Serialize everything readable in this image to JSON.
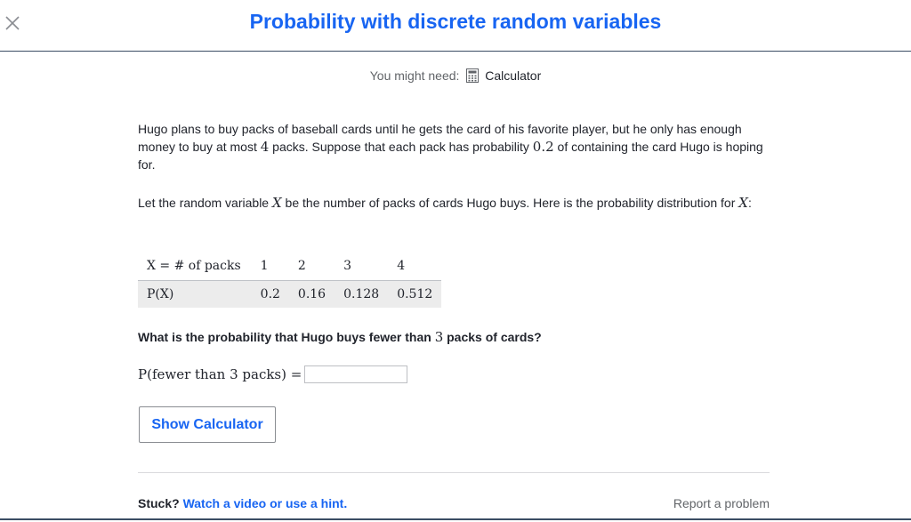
{
  "header": {
    "title": "Probability with discrete random variables",
    "close_icon": "close-icon"
  },
  "tools": {
    "label": "You might need:",
    "calculator_label": "Calculator",
    "calculator_icon": "calculator-icon"
  },
  "problem": {
    "p1_a": "Hugo plans to buy packs of baseball cards until he gets the card of his favorite player, but he only has enough money to buy at most ",
    "p1_num": "4",
    "p1_b": " packs. Suppose that each pack has probability ",
    "p1_prob": "0.2",
    "p1_c": " of containing the card Hugo is hoping for.",
    "p2_a": "Let the random variable ",
    "p2_var": "X",
    "p2_b": " be the number of packs of cards Hugo buys. Here is the probability distribution for ",
    "p2_var2": "X",
    "p2_c": ":"
  },
  "table": {
    "row1_header": "X = # of packs",
    "row2_header": "P(X)",
    "x_values": [
      "1",
      "2",
      "3",
      "4"
    ],
    "p_values": [
      "0.2",
      "0.16",
      "0.128",
      "0.512"
    ]
  },
  "question": {
    "text_a": "What is the probability that Hugo buys fewer than ",
    "num": "3",
    "text_b": " packs of cards?",
    "answer_label": "P(fewer than 3 packs) =",
    "answer_value": ""
  },
  "buttons": {
    "show_calculator": "Show Calculator"
  },
  "footer": {
    "stuck": "Stuck?",
    "hint_link": "Watch a video or use a hint.",
    "report": "Report a problem"
  },
  "colors": {
    "accent": "#1865f2",
    "text": "#21242c",
    "muted": "#626569"
  }
}
